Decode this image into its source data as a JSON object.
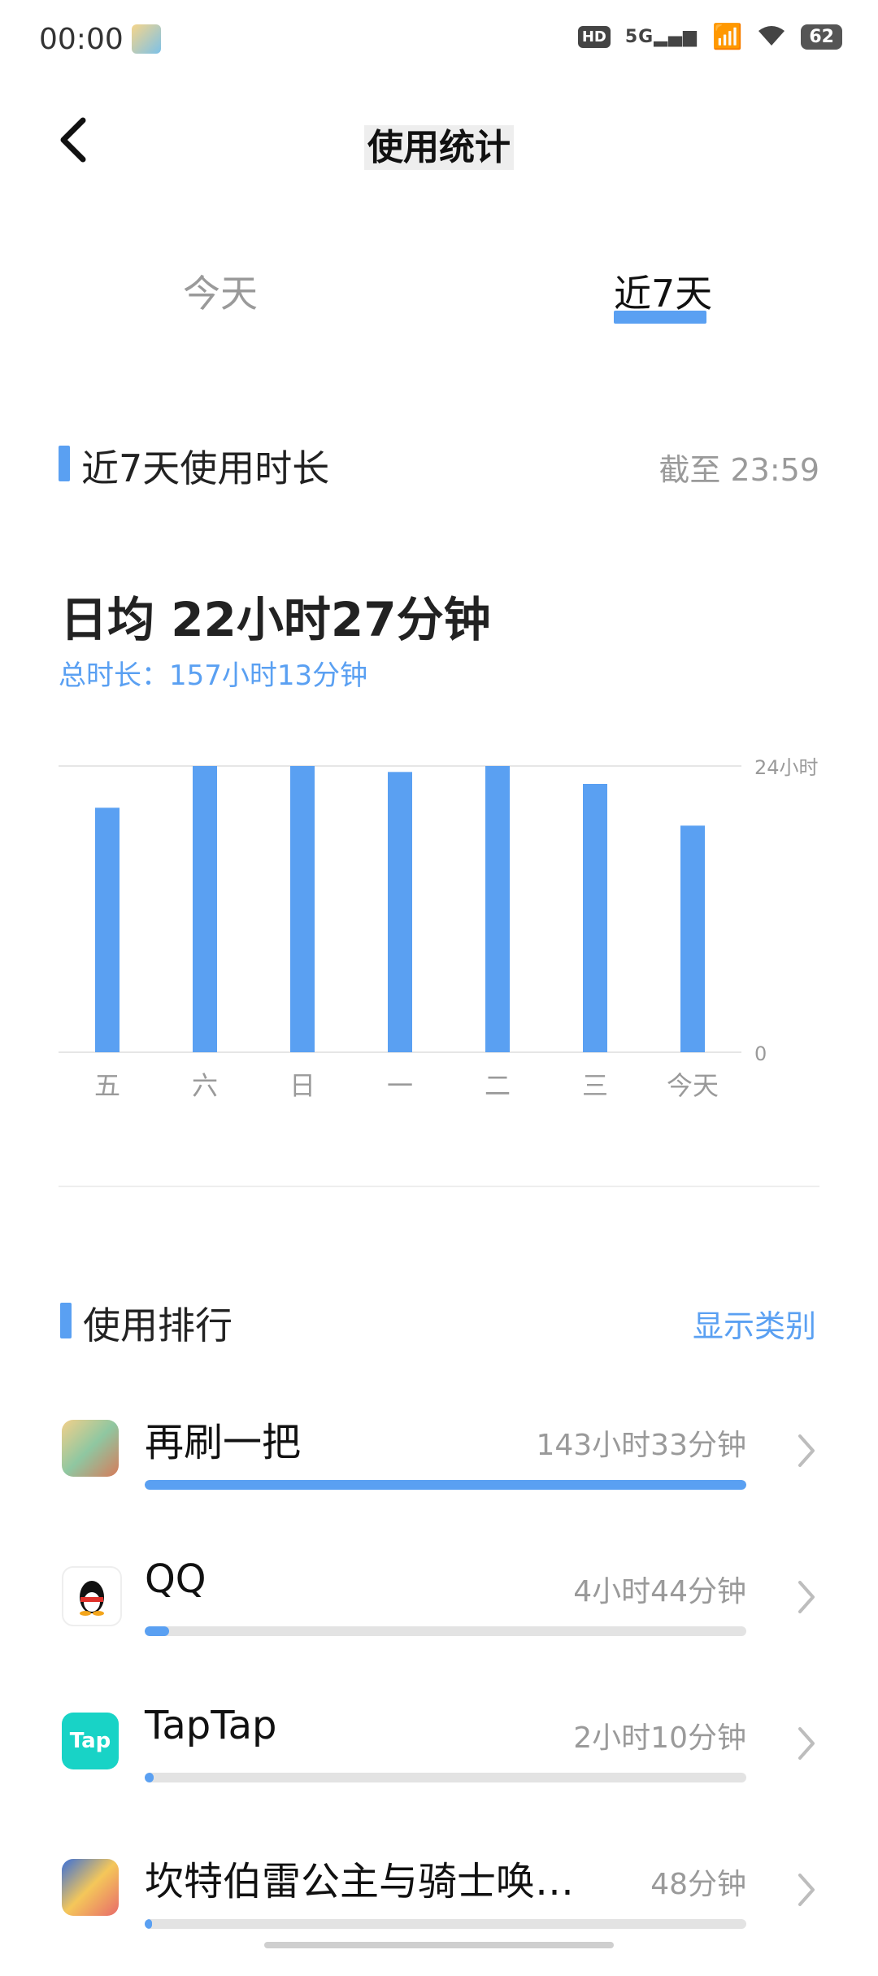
{
  "status": {
    "time": "00:00",
    "hd": "HD",
    "network": "5G",
    "battery": "62"
  },
  "header": {
    "title": "使用统计"
  },
  "tabs": [
    {
      "label": "今天"
    },
    {
      "label": "近7天"
    }
  ],
  "usage_section": {
    "title": "近7天使用时长",
    "cutoff": "截至 23:59",
    "daily_average": "日均 22小时27分钟",
    "total": "总时长：157小时13分钟"
  },
  "chart_data": {
    "type": "bar",
    "categories": [
      "五",
      "六",
      "日",
      "一",
      "二",
      "三",
      "今天"
    ],
    "values": [
      20.5,
      24.0,
      24.0,
      23.5,
      24.0,
      22.5,
      19.0
    ],
    "ylim": [
      0,
      24
    ],
    "y_tick_labels": [
      "0",
      "24小时"
    ],
    "color": "#5aa0f2"
  },
  "ranking": {
    "title": "使用排行",
    "action": "显示类别",
    "items": [
      {
        "name": "再刷一把",
        "time": "143小时33分钟",
        "fraction": 1.0,
        "icon": "game-icon"
      },
      {
        "name": "QQ",
        "time": "4小时44分钟",
        "fraction": 0.04,
        "icon": "qq-penguin-icon"
      },
      {
        "name": "TapTap",
        "time": "2小时10分钟",
        "fraction": 0.015,
        "icon": "taptap-icon",
        "icon_text": "Tap"
      },
      {
        "name": "坎特伯雷公主与骑士唤…",
        "time": "48分钟",
        "fraction": 0.008,
        "icon": "game-princess-icon"
      }
    ]
  }
}
